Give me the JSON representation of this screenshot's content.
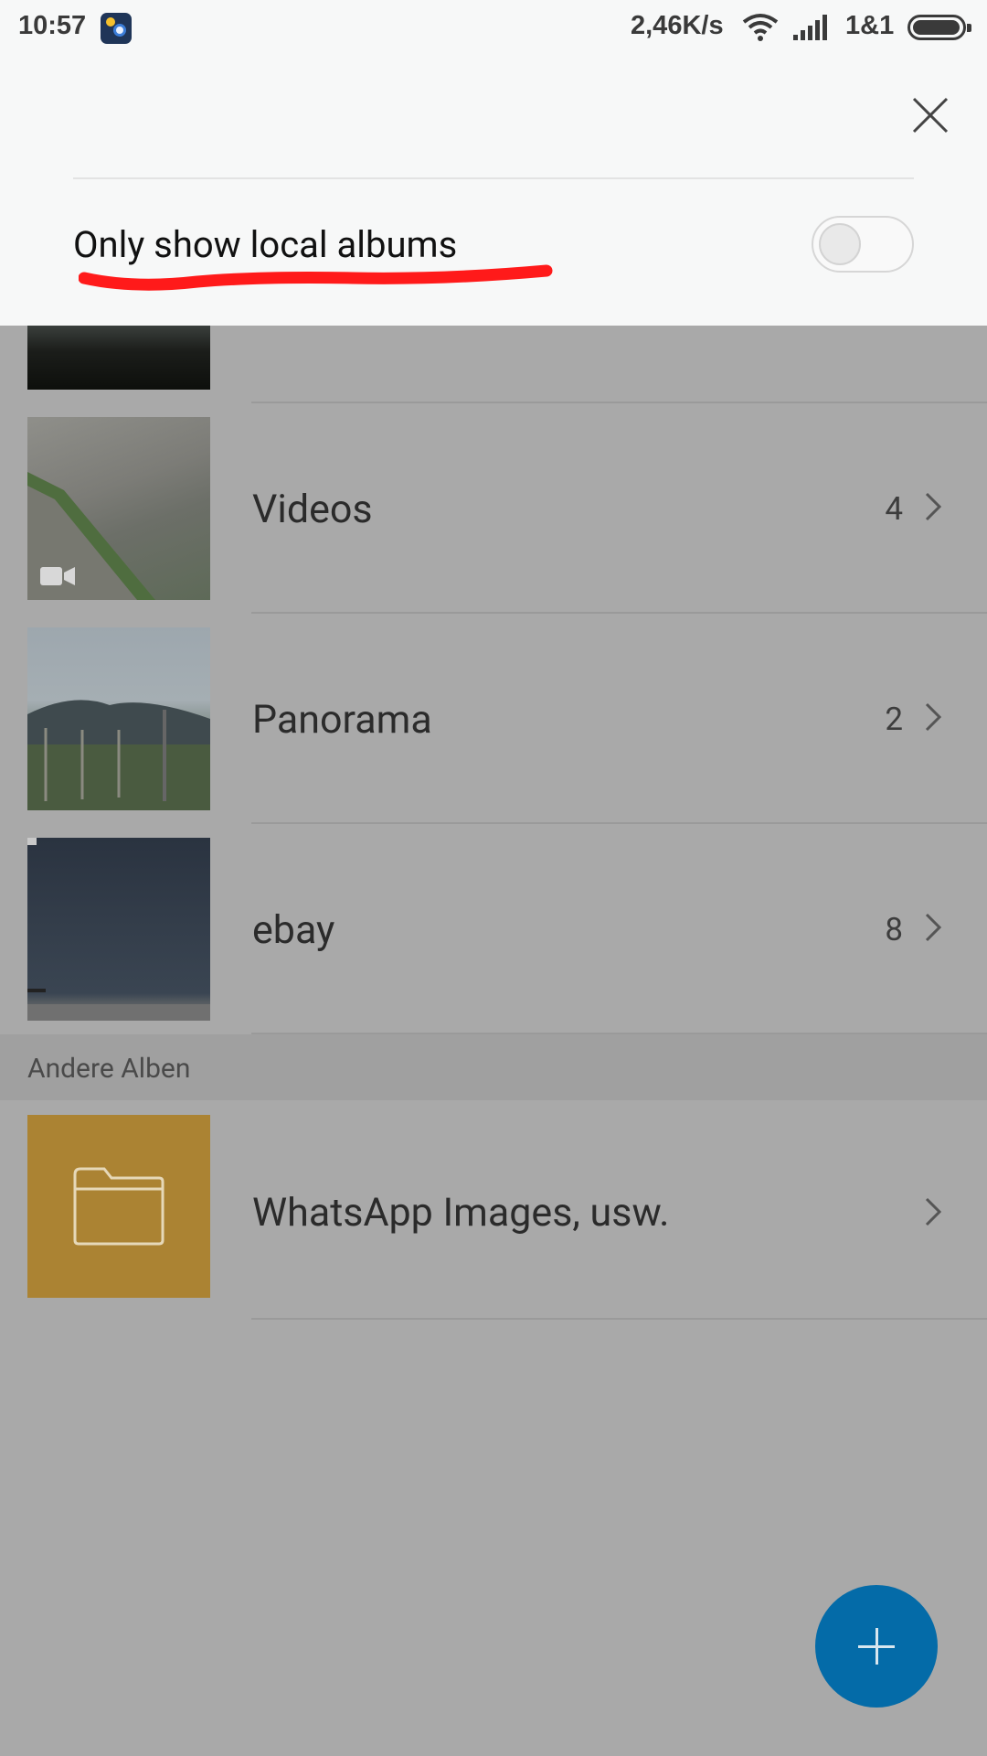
{
  "status_bar": {
    "time": "10:57",
    "net_speed": "2,46K/s",
    "carrier": "1&1",
    "icons": [
      "app-notification-icon",
      "wifi-icon",
      "signal-icon",
      "battery-icon"
    ]
  },
  "panel": {
    "toggle_label": "Only show local albums",
    "toggle_on": false,
    "close_icon": "close-icon"
  },
  "albums": [
    {
      "title": "Videos",
      "count": "4"
    },
    {
      "title": "Panorama",
      "count": "2"
    },
    {
      "title": "ebay",
      "count": "8"
    }
  ],
  "other_section": {
    "header": "Andere Alben",
    "item": {
      "title": "WhatsApp Images, usw."
    }
  },
  "fab": {
    "icon": "plus-icon"
  },
  "colors": {
    "background": "#a9a9a9",
    "panel": "#f7f8f8",
    "folder_thumb": "#ab8333",
    "fab": "#046ba8",
    "annotation": "#ff1a1a"
  }
}
